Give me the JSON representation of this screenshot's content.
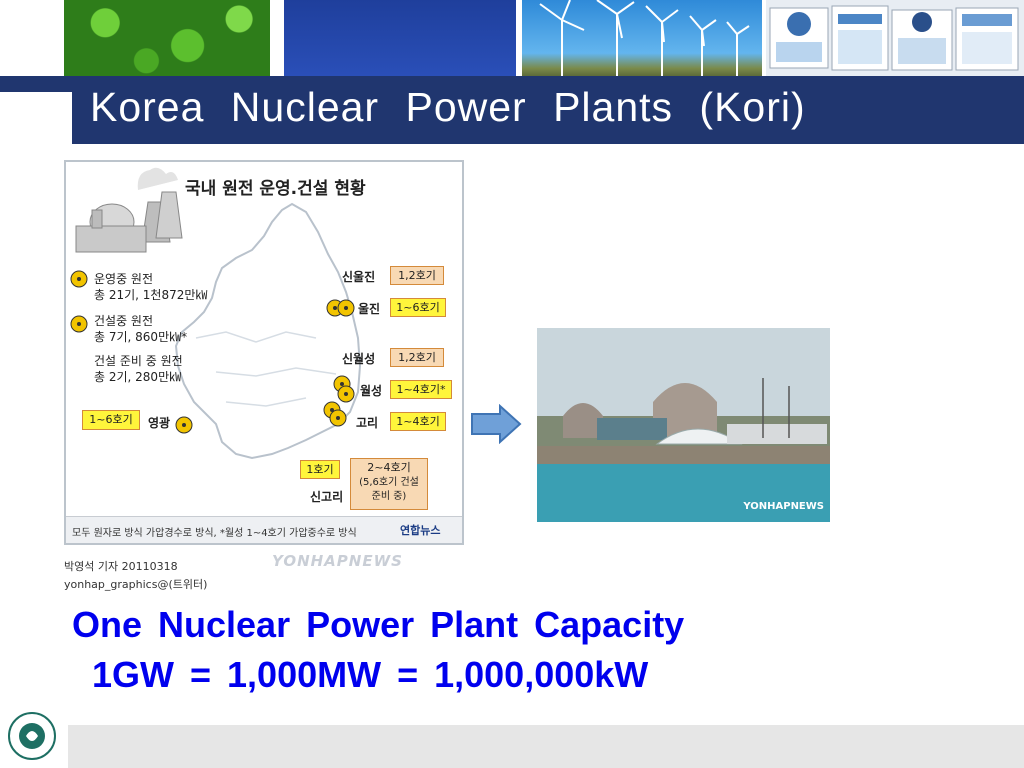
{
  "slide": {
    "title": "Korea Nuclear Power Plants (Kori)"
  },
  "infographic": {
    "heading": "국내 원전 운영.건설 현황",
    "legend": {
      "operating": "운영중  원전",
      "operating_count": "총 21기, 1천872만㎾",
      "construction": "건설중  원전",
      "construction_count": "총 7기, 860만㎾*",
      "planned": "건설 준비 중  원전",
      "planned_count": "총 2기, 280만㎾"
    },
    "sites": {
      "shinuljin": "신울진",
      "uljin": "울진",
      "shinwolseong": "신월성",
      "wolseong": "월성",
      "gori": "고리",
      "shingori": "신고리",
      "yeonggwang": "영광"
    },
    "tags": {
      "shinuljin": "1,2호기",
      "uljin": "1~6호기",
      "shinwolseong": "1,2호기",
      "wolseong": "1~4호기*",
      "gori": "1~4호기",
      "shingori_1": "1호기",
      "shingori_2": "2~4호기",
      "shingori_note_1": "(5,6호기 건설",
      "shingori_note_2": "준비 중)",
      "yeonggwang": "1~6호기"
    },
    "footer_note": "모두 원자로 방식 가압경수로 방식, *월성 1~4호기 가압중수로 방식",
    "agency": "연합뉴스"
  },
  "credits": {
    "reporter": "박영석 기자 20110318",
    "contact": "yonhap_graphics@(트위터)",
    "watermark": "YONHAPNEWS"
  },
  "photo": {
    "watermark": "YONHAPNEWS"
  },
  "capacity": {
    "line1": "One Nuclear Power Plant Capacity",
    "line2": "1GW = 1,000MW = 1,000,000kW"
  },
  "colors": {
    "title_band": "#20366f",
    "capacity_text": "#0000ee",
    "arrow_fill": "#6fa0d8"
  }
}
